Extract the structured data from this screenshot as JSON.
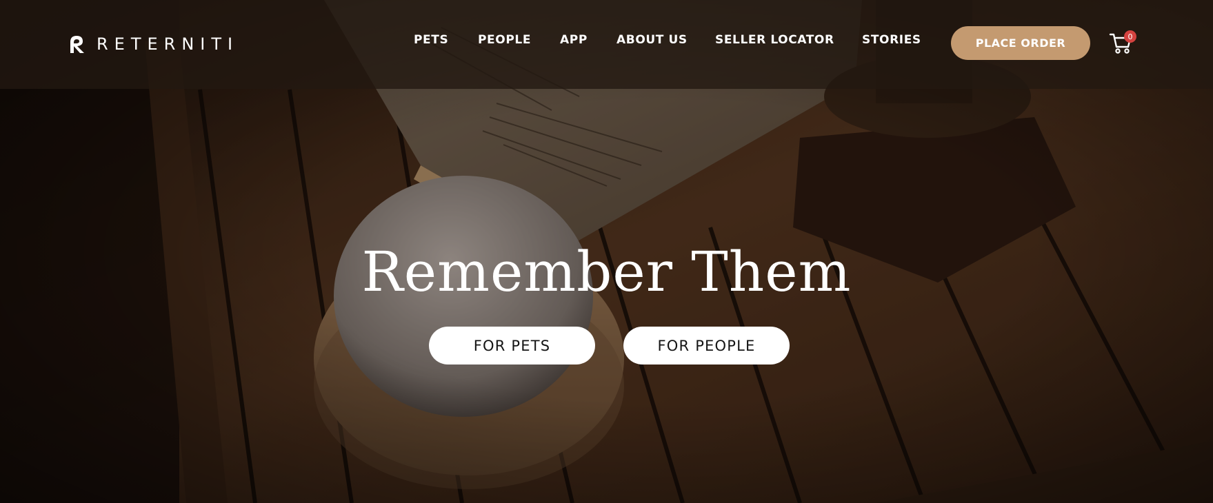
{
  "brand": {
    "name": "RETERNITI"
  },
  "nav": {
    "items": [
      {
        "label": "PETS"
      },
      {
        "label": "PEOPLE"
      },
      {
        "label": "APP"
      },
      {
        "label": "ABOUT US"
      },
      {
        "label": "SELLER LOCATOR"
      },
      {
        "label": "STORIES"
      }
    ],
    "order_button": "PLACE ORDER",
    "cart_count": "0",
    "cart_icon": "cart-icon"
  },
  "hero": {
    "headline": "Remember Them",
    "cta_pets": "FOR PETS",
    "cta_people": "FOR PEOPLE"
  },
  "colors": {
    "accent": "#c49a70",
    "badge": "#d4423f",
    "header_bg": "#221811"
  }
}
